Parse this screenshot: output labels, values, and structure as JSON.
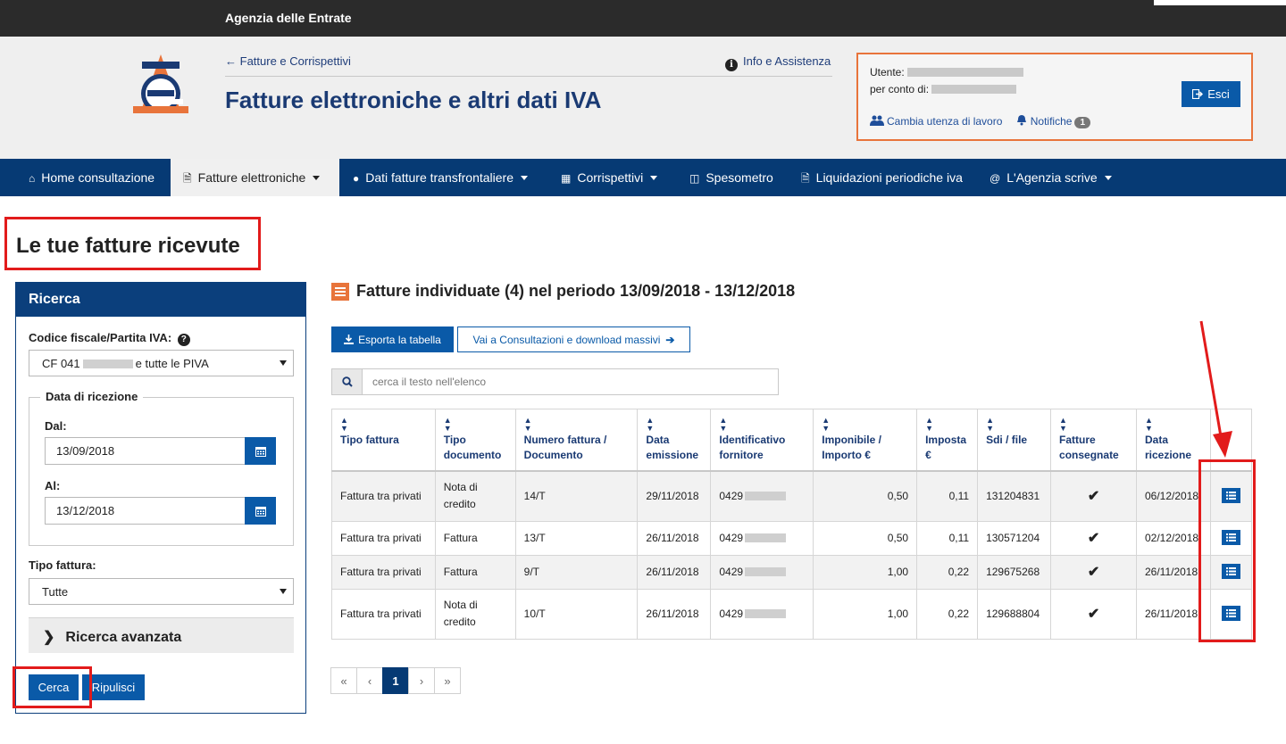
{
  "topbar": {
    "agency": "Agenzia delle Entrate"
  },
  "header": {
    "back_link": "Fatture e Corrispettivi",
    "info_link": "Info e Assistenza",
    "title": "Fatture elettroniche e altri dati IVA"
  },
  "user": {
    "utente_label": "Utente:",
    "per_conto_label": "per conto di:",
    "change_label": "Cambia utenza di lavoro",
    "notif_label": "Notifiche",
    "notif_count": "1",
    "logout_label": "Esci"
  },
  "nav": [
    {
      "label": "Home consultazione",
      "icon": "home-icon"
    },
    {
      "label": "Fatture elettroniche",
      "icon": "file-icon",
      "active": true
    },
    {
      "label": "Dati fatture transfrontaliere",
      "icon": "globe-icon"
    },
    {
      "label": "Corrispettivi",
      "icon": "calculator-icon"
    },
    {
      "label": "Spesometro",
      "icon": "shopping-bag-icon"
    },
    {
      "label": "Liquidazioni periodiche iva",
      "icon": "file-icon"
    },
    {
      "label": "L'Agenzia scrive",
      "icon": "at-icon"
    }
  ],
  "page_title": "Le tue fatture ricevute",
  "search_panel": {
    "title": "Ricerca",
    "cf_label": "Codice fiscale/Partita IVA:",
    "cf_prefix": "CF 041",
    "cf_suffix": "e tutte le PIVA",
    "date_group": "Data di ricezione",
    "from_label": "Dal:",
    "from_value": "13/09/2018",
    "to_label": "Al:",
    "to_value": "13/12/2018",
    "type_label": "Tipo fattura:",
    "type_value": "Tutte",
    "advanced": "Ricerca avanzata",
    "search_btn": "Cerca",
    "clear_btn": "Ripulisci"
  },
  "results": {
    "title": "Fatture individuate (4) nel periodo 13/09/2018 - 13/12/2018",
    "export_btn": "Esporta la tabella",
    "bulk_btn": "Vai a Consultazioni e download massivi",
    "filter_placeholder": "cerca il testo nell'elenco",
    "columns": [
      "Tipo fattura",
      "Tipo documento",
      "Numero fattura / Documento",
      "Data emissione",
      "Identificativo fornitore",
      "Imponibile / Importo €",
      "Imposta €",
      "Sdi / file",
      "Fatture consegnate",
      "Data ricezione"
    ],
    "rows": [
      {
        "tipo_fattura": "Fattura tra privati",
        "tipo_doc": "Nota di credito",
        "numero": "14/T",
        "data_emissione": "29/11/2018",
        "fornitore": "0429",
        "imponibile": "0,50",
        "imposta": "0,11",
        "sdi": "131204831",
        "data_ricezione": "06/12/2018"
      },
      {
        "tipo_fattura": "Fattura tra privati",
        "tipo_doc": "Fattura",
        "numero": "13/T",
        "data_emissione": "26/11/2018",
        "fornitore": "0429",
        "imponibile": "0,50",
        "imposta": "0,11",
        "sdi": "130571204",
        "data_ricezione": "02/12/2018"
      },
      {
        "tipo_fattura": "Fattura tra privati",
        "tipo_doc": "Fattura",
        "numero": "9/T",
        "data_emissione": "26/11/2018",
        "fornitore": "0429",
        "imponibile": "1,00",
        "imposta": "0,22",
        "sdi": "129675268",
        "data_ricezione": "26/11/2018"
      },
      {
        "tipo_fattura": "Fattura tra privati",
        "tipo_doc": "Nota di credito",
        "numero": "10/T",
        "data_emissione": "26/11/2018",
        "fornitore": "0429",
        "imponibile": "1,00",
        "imposta": "0,22",
        "sdi": "129688804",
        "data_ricezione": "26/11/2018"
      }
    ],
    "pager": [
      "«",
      "‹",
      "1",
      "›",
      "»"
    ]
  },
  "colors": {
    "navy": "#063a74",
    "blue": "#0a5aa8",
    "orange": "#e8743b",
    "red": "#e21b1b"
  }
}
